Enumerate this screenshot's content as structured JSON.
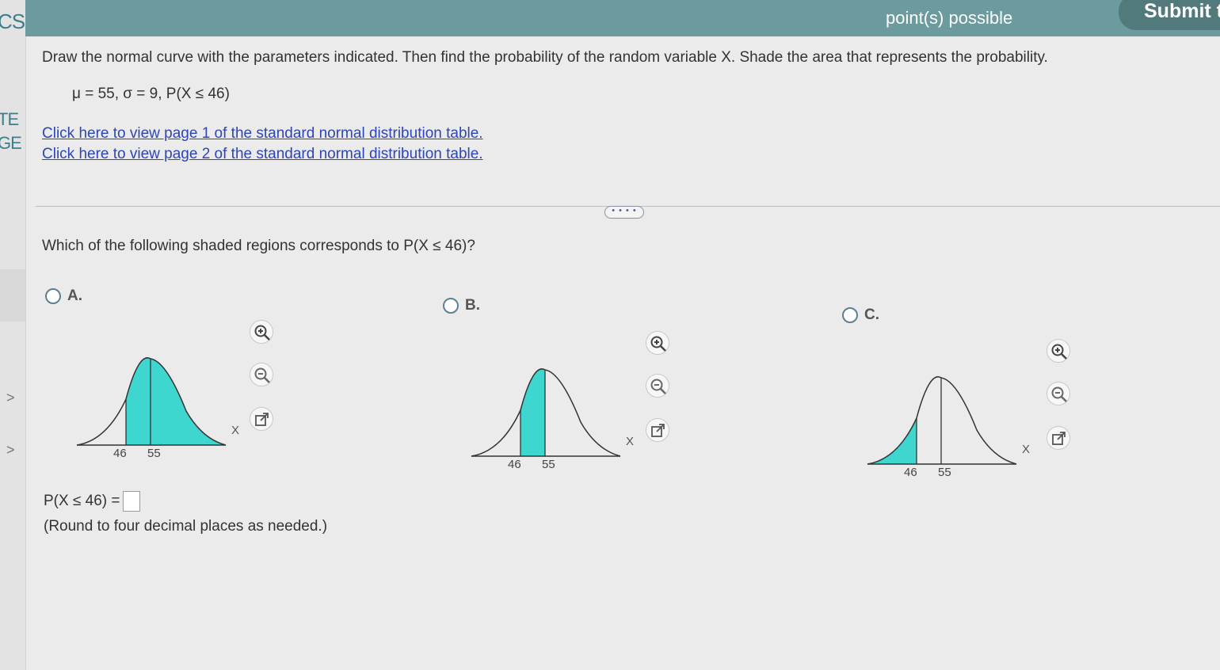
{
  "rail": {
    "top_fragment": "CS",
    "te_fragment": "TE",
    "ge_fragment": "GE",
    "chevron": ">"
  },
  "header": {
    "points": "point(s) possible",
    "submit_label": "Submit tes"
  },
  "problem": {
    "instructions": "Draw the normal curve with the parameters indicated. Then find the probability of the random variable X. Shade the area that represents the probability.",
    "parameters": "μ = 55, σ = 9, P(X ≤ 46)",
    "link_page1": "Click here to view page 1 of the standard normal distribution table.",
    "link_page2": "Click here to view page 2 of the standard normal distribution table.",
    "expand_label": "• • • •"
  },
  "question": {
    "text": "Which of the following shaded regions corresponds to P(X ≤ 46)?",
    "options": [
      {
        "label": "A.",
        "tick_left": "46",
        "tick_right": "55",
        "x_label": "X",
        "shaded": "right of 46"
      },
      {
        "label": "B.",
        "tick_left": "46",
        "tick_right": "55",
        "x_label": "X",
        "shaded": "between 46 and 55"
      },
      {
        "label": "C.",
        "tick_left": "46",
        "tick_right": "55",
        "x_label": "X",
        "shaded": "left of 46"
      }
    ]
  },
  "answer": {
    "prompt": "P(X ≤ 46) =",
    "value": "",
    "note": "(Round to four decimal places as needed.)"
  },
  "colors": {
    "header_bg": "#6b9b9e",
    "shade": "#3fd6d0",
    "link": "#2c45b8"
  }
}
